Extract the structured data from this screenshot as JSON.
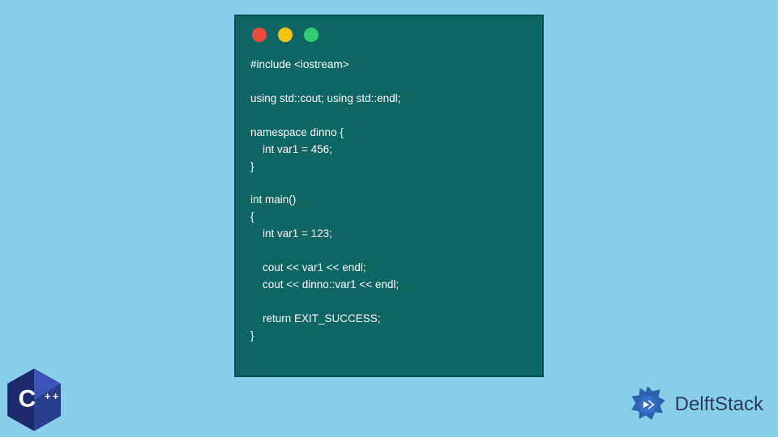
{
  "window": {
    "traffic_lights": [
      "red",
      "yellow",
      "green"
    ]
  },
  "code": {
    "lines": [
      "#include <iostream>",
      "",
      "using std::cout; using std::endl;",
      "",
      "namespace dinno {",
      "    int var1 = 456;",
      "}",
      "",
      "int main()",
      "{",
      "    int var1 = 123;",
      "",
      "    cout << var1 << endl;",
      "    cout << dinno::var1 << endl;",
      "",
      "    return EXIT_SUCCESS;",
      "}"
    ]
  },
  "cpp_badge": {
    "label": "C++"
  },
  "brand": {
    "name": "DelftStack"
  },
  "colors": {
    "page_bg": "#87ceeb",
    "window_bg": "#0d6663",
    "code_text": "#ffffff",
    "brand_text": "#2b3a5b",
    "cpp_badge": "#1b2a6b"
  }
}
